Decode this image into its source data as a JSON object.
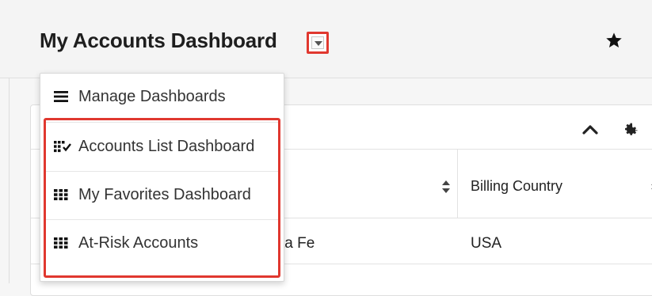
{
  "header": {
    "title": "My Accounts Dashboard",
    "dropdown_icon": "caret-down-icon",
    "favorite_icon": "star-icon"
  },
  "dropdown_menu": {
    "items": [
      {
        "label": "Manage Dashboards",
        "icon": "hamburger-icon"
      },
      {
        "label": "Accounts List Dashboard",
        "icon": "list-dashboard-icon"
      },
      {
        "label": "My Favorites Dashboard",
        "icon": "grid-dashboard-icon"
      },
      {
        "label": "At-Risk Accounts",
        "icon": "grid-dashboard-icon"
      }
    ]
  },
  "dashlet": {
    "collapse_icon": "chevron-up-icon",
    "settings_icon": "gear-icon",
    "columns": [
      {
        "label": "",
        "sort_icon": "sort-icon"
      },
      {
        "label": "Billing Country",
        "sort_icon": "sort-icon"
      }
    ],
    "rows": [
      {
        "city": "ta Fe",
        "country": "USA"
      }
    ]
  },
  "colors": {
    "highlight": "#e0382f",
    "background": "#f6f6f6",
    "panel": "#ffffff"
  }
}
